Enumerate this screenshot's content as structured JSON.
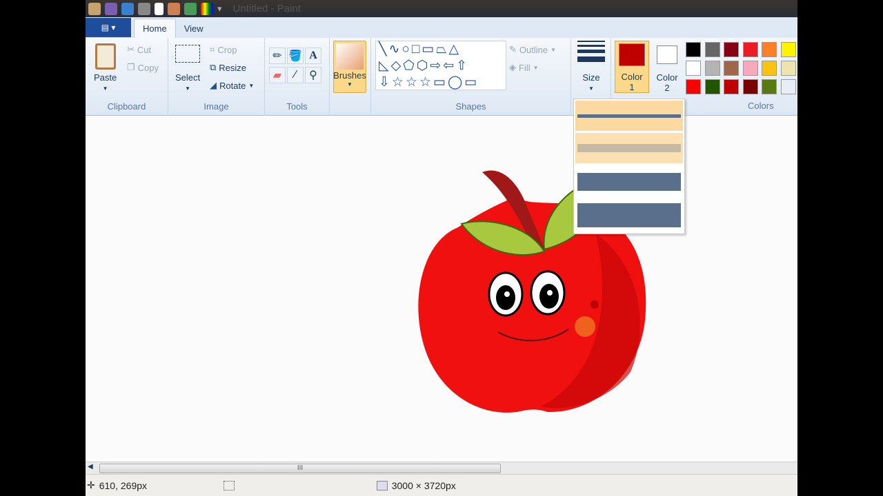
{
  "window": {
    "title": "Untitled - Paint"
  },
  "quick_access": [
    "paint-icon",
    "save-icon",
    "undo-icon",
    "redo-icon",
    "new-icon",
    "fill-icon",
    "paint3d-icon",
    "colors-icon",
    "customize-icon"
  ],
  "tabs": [
    {
      "label": "Home",
      "active": true
    },
    {
      "label": "View",
      "active": false
    }
  ],
  "clipboard": {
    "paste": "Paste",
    "cut": "Cut",
    "copy": "Copy",
    "label": "Clipboard"
  },
  "image": {
    "select": "Select",
    "crop": "Crop",
    "resize": "Resize",
    "rotate": "Rotate",
    "label": "Image"
  },
  "tools": {
    "label": "Tools",
    "items": [
      "pencil",
      "fill",
      "text",
      "eraser",
      "color-picker",
      "magnifier"
    ]
  },
  "brushes": {
    "label": "Brushes"
  },
  "shapes": {
    "label": "Shapes",
    "outline": "Outline",
    "fill": "Fill"
  },
  "size": {
    "label": "Size"
  },
  "color1": {
    "label": "Color",
    "num": "1",
    "value": "#c00000"
  },
  "color2": {
    "label": "Color",
    "num": "2",
    "value": "#ffffff"
  },
  "colors": {
    "label": "Colors",
    "palette": [
      "#000000",
      "#666666",
      "#880015",
      "#ed1c24",
      "#ff7f27",
      "#fff200",
      "#ffffff",
      "#b4b4b4",
      "#a0664b",
      "#f7a8bc",
      "#ffc20e",
      "#efe4b0",
      "#ff0000",
      "#225500",
      "#c00000",
      "#7b0000",
      "#5a7a10",
      "#e8eef6"
    ]
  },
  "status": {
    "cursor": "610, 269px",
    "canvas_size": "3000 × 3720px"
  },
  "scrollbar": {
    "grip": "III"
  }
}
